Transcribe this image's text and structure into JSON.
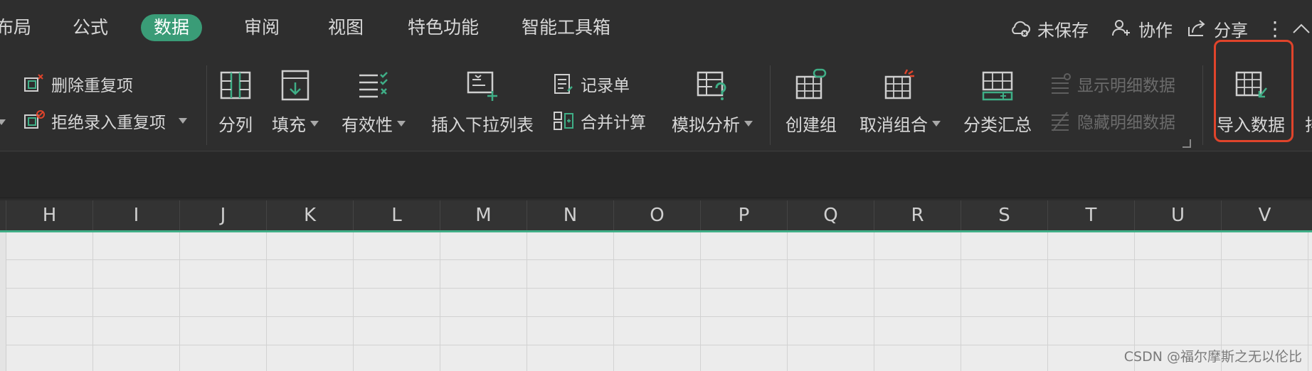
{
  "tabs": [
    {
      "label": "布局",
      "active": false
    },
    {
      "label": "公式",
      "active": false
    },
    {
      "label": "数据",
      "active": true
    },
    {
      "label": "审阅",
      "active": false
    },
    {
      "label": "视图",
      "active": false
    },
    {
      "label": "特色功能",
      "active": false
    },
    {
      "label": "智能工具箱",
      "active": false
    }
  ],
  "right_tools": {
    "unsaved": "未保存",
    "collab": "协作",
    "share": "分享"
  },
  "ribbon": {
    "delete_duplicates": "删除重复项",
    "reject_duplicates": "拒绝录入重复项",
    "split_column": "分列",
    "fill": "填充",
    "validity": "有效性",
    "insert_dropdown": "插入下拉列表",
    "record_form": "记录单",
    "consolidate": "合并计算",
    "what_if": "模拟分析",
    "create_group": "创建组",
    "ungroup": "取消组合",
    "subtotal": "分类汇总",
    "show_detail": "显示明细数据",
    "hide_detail": "隐藏明细数据",
    "import_data": "导入数据",
    "more_cut": "排"
  },
  "columns": [
    "H",
    "I",
    "J",
    "K",
    "L",
    "M",
    "N",
    "O",
    "P",
    "Q",
    "R",
    "S",
    "T",
    "U",
    "V"
  ],
  "watermark": "CSDN @福尔摩斯之无以伦比",
  "colors": {
    "accent": "#3a9c77",
    "highlight": "#e0442b"
  }
}
